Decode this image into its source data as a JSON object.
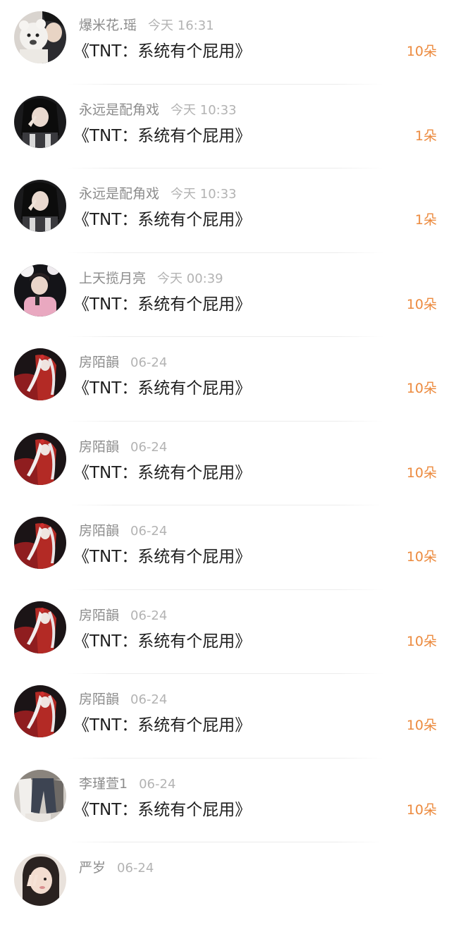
{
  "items": [
    {
      "name": "爆米花.瑶",
      "time": "今天 16:31",
      "title": "《TNT：系统有个屁用》",
      "gift": "10朵",
      "avatar": "avatar-white-teddy"
    },
    {
      "name": "永远是配角戏",
      "time": "今天 10:33",
      "title": "《TNT：系统有个屁用》",
      "gift": "1朵",
      "avatar": "avatar-dark-girl"
    },
    {
      "name": "永远是配角戏",
      "time": "今天 10:33",
      "title": "《TNT：系统有个屁用》",
      "gift": "1朵",
      "avatar": "avatar-dark-girl"
    },
    {
      "name": "上天揽月亮",
      "time": "今天 00:39",
      "title": "《TNT：系统有个屁用》",
      "gift": "10朵",
      "avatar": "avatar-pink-boy"
    },
    {
      "name": "房陌韻",
      "time": "06-24",
      "title": "《TNT：系统有个屁用》",
      "gift": "10朵",
      "avatar": "avatar-red-art"
    },
    {
      "name": "房陌韻",
      "time": "06-24",
      "title": "《TNT：系统有个屁用》",
      "gift": "10朵",
      "avatar": "avatar-red-art"
    },
    {
      "name": "房陌韻",
      "time": "06-24",
      "title": "《TNT：系统有个屁用》",
      "gift": "10朵",
      "avatar": "avatar-red-art"
    },
    {
      "name": "房陌韻",
      "time": "06-24",
      "title": "《TNT：系统有个屁用》",
      "gift": "10朵",
      "avatar": "avatar-red-art"
    },
    {
      "name": "房陌韻",
      "time": "06-24",
      "title": "《TNT：系统有个屁用》",
      "gift": "10朵",
      "avatar": "avatar-red-art"
    },
    {
      "name": "李瑾萱1",
      "time": "06-24",
      "title": "《TNT：系统有个屁用》",
      "gift": "10朵",
      "avatar": "avatar-clothes"
    },
    {
      "name": "严岁",
      "time": "06-24",
      "title": "",
      "gift": "",
      "avatar": "avatar-peace-girl"
    }
  ]
}
